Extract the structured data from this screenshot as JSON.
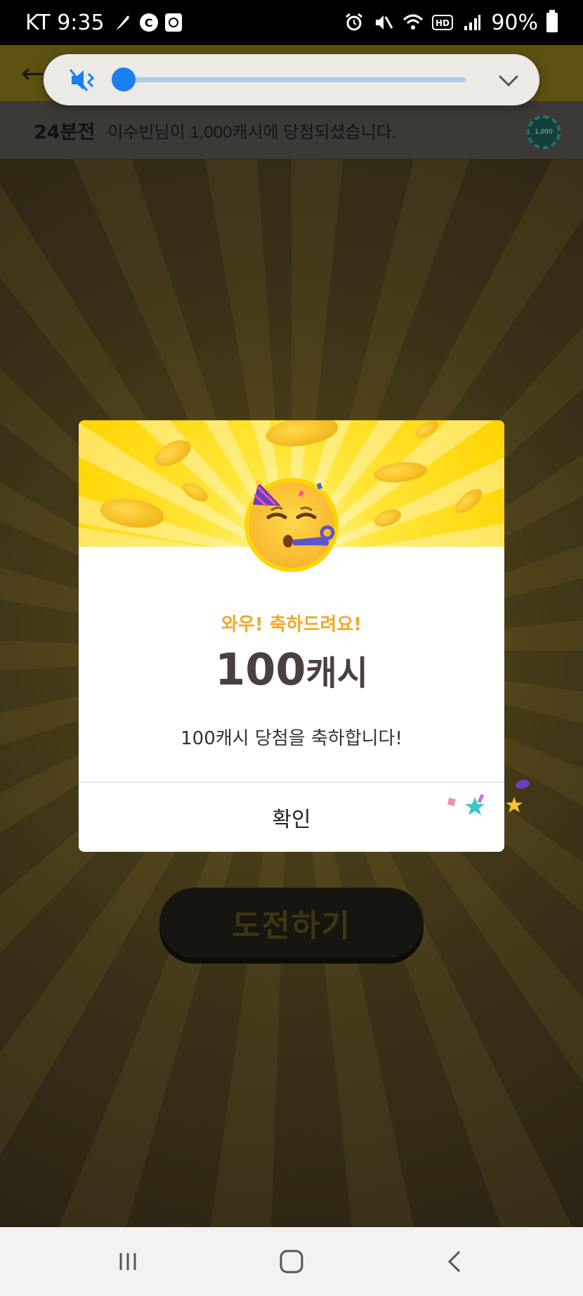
{
  "status_bar": {
    "carrier_time": "KT 9:35",
    "battery": "90%",
    "icons": [
      "feather-icon",
      "c-icon",
      "square-icon",
      "alarm-icon",
      "mute-icon",
      "wifi-icon",
      "hd-icon",
      "signal-icon",
      "battery-icon"
    ]
  },
  "ticker": {
    "time_ago": "24분전",
    "message": "이수빈님이 1,000캐시에 당첨되셨습니다.",
    "chip_label": "1,000"
  },
  "volume": {
    "level": 0,
    "icon": "mute-icon",
    "accent": "#1a7ff0"
  },
  "dialog": {
    "subtitle": "와우! 축하드려요!",
    "amount": "100",
    "unit": "캐시",
    "message": "100캐시 당첨을 축하합니다!",
    "confirm_label": "확인",
    "subtitle_color": "#f0a92a"
  },
  "background": {
    "challenge_label": "도전하기"
  },
  "nav": {
    "icons": [
      "recent-apps-icon",
      "home-icon",
      "back-icon"
    ]
  }
}
